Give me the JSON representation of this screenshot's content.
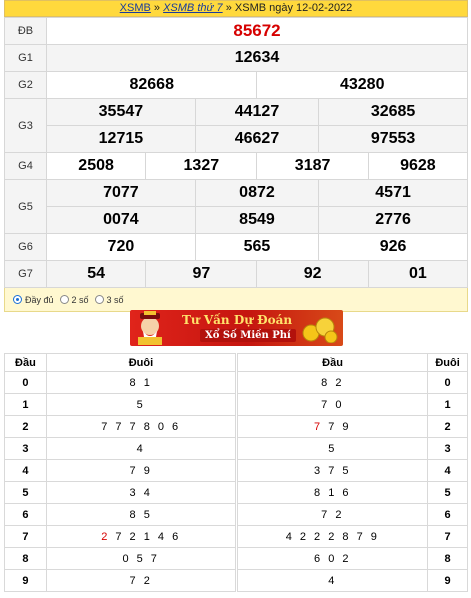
{
  "breadcrumb": {
    "link1": "XSMB",
    "sep1": " » ",
    "link2": "XSMB thứ 7",
    "sep2": " » ",
    "current": "XSMB ngày 12-02-2022"
  },
  "results": [
    {
      "label": "ĐB",
      "numbers": [
        "85672"
      ]
    },
    {
      "label": "G1",
      "numbers": [
        "12634"
      ]
    },
    {
      "label": "G2",
      "numbers": [
        "82668",
        "43280"
      ]
    },
    {
      "label": "G3",
      "numbers": [
        "35547",
        "44127",
        "32685",
        "12715",
        "46627",
        "97553"
      ]
    },
    {
      "label": "G4",
      "numbers": [
        "2508",
        "1327",
        "3187",
        "9628"
      ]
    },
    {
      "label": "G5",
      "numbers": [
        "7077",
        "0872",
        "4571",
        "0074",
        "8549",
        "2776"
      ]
    },
    {
      "label": "G6",
      "numbers": [
        "720",
        "565",
        "926"
      ]
    },
    {
      "label": "G7",
      "numbers": [
        "54",
        "97",
        "92",
        "01"
      ]
    }
  ],
  "view_options": {
    "selected": "Đầy đủ",
    "items": [
      "Đầy đủ",
      "2 số",
      "3 số"
    ]
  },
  "banner": {
    "line1": "Tư Vấn Dự Đoán",
    "line2": "Xổ Số Miền Phí"
  },
  "loto": {
    "headers": [
      "Đầu",
      "Đuôi",
      "Đầu",
      "Đuôi"
    ],
    "rows": [
      {
        "dau": "0",
        "duoi": "8 1",
        "dau2": "8 2",
        "duoi2": "0"
      },
      {
        "dau": "1",
        "duoi": "5",
        "dau2": "7 0",
        "duoi2": "1"
      },
      {
        "dau": "2",
        "duoi": "7 7 7 8 0 6",
        "dau2_hl": "7",
        "dau2": " 7 9",
        "duoi2": "2"
      },
      {
        "dau": "3",
        "duoi": "4",
        "dau2": "5",
        "duoi2": "3"
      },
      {
        "dau": "4",
        "duoi": "7 9",
        "dau2": "3 7 5",
        "duoi2": "4"
      },
      {
        "dau": "5",
        "duoi": "3 4",
        "dau2": "8 1 6",
        "duoi2": "5"
      },
      {
        "dau": "6",
        "duoi": "8 5",
        "dau2": "7 2",
        "duoi2": "6"
      },
      {
        "dau": "7",
        "duoi_hl": "2",
        "duoi": " 7 2 1 4 6",
        "dau2": "4 2 2 2 8 7 9",
        "duoi2": "7"
      },
      {
        "dau": "8",
        "duoi": "0 5 7",
        "dau2": "6 0 2",
        "duoi2": "8"
      },
      {
        "dau": "9",
        "duoi": "7 2",
        "dau2": "4",
        "duoi2": "9"
      }
    ]
  },
  "colors": {
    "special_prize": "#d60000",
    "crumb_bg": "#ffd93d",
    "link": "#1a3c9e"
  }
}
